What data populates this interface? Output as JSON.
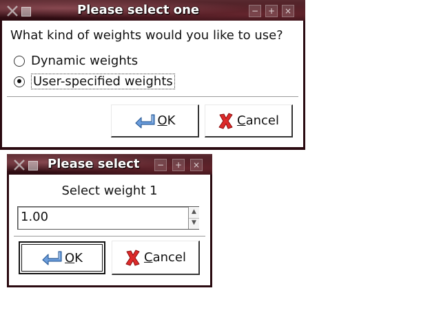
{
  "dialog1": {
    "title": "Please select one",
    "question": "What kind of weights would you like to use?",
    "options": [
      {
        "label": "Dynamic weights",
        "selected": false
      },
      {
        "label": "User-specified weights",
        "selected": true
      }
    ],
    "ok_rest": "K",
    "ok_mnemonic": "O",
    "cancel_mnemonic": "C",
    "cancel_rest": "ancel"
  },
  "dialog2": {
    "title": "Please select",
    "prompt": "Select weight 1",
    "value": "1.00",
    "ok_mnemonic": "O",
    "ok_rest": "K",
    "cancel_mnemonic": "C",
    "cancel_rest": "ancel"
  },
  "icons": {
    "ok": "enter-arrow-icon",
    "cancel": "red-x-icon",
    "menu": "x-logo-icon"
  },
  "colors": {
    "titlebar": "#3a1218",
    "ok_icon": "#5b8fd0",
    "cancel_icon": "#d22020"
  }
}
